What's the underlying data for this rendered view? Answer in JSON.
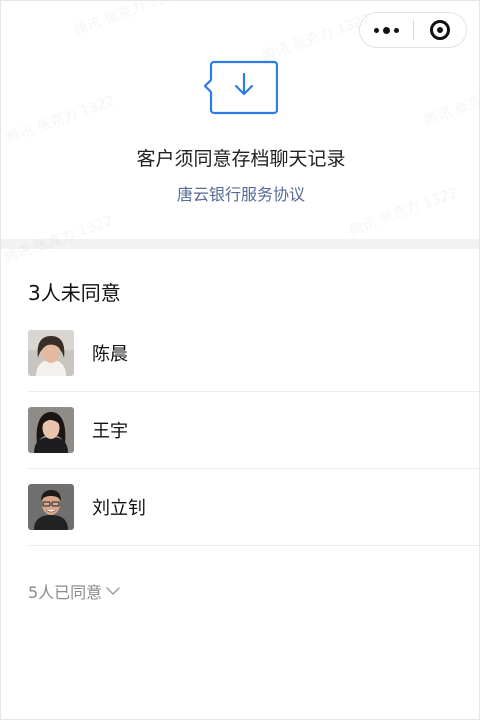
{
  "watermark": {
    "text": "腾讯 张克力 1322"
  },
  "capsule": {
    "more_icon": "more-dots-icon",
    "close_icon": "mini-program-close-icon"
  },
  "header": {
    "icon": "archive-download-icon",
    "title": "客户须同意存档聊天记录",
    "agreement_link": "唐云银行服务协议"
  },
  "not_agreed": {
    "title": "3人未同意",
    "people": [
      {
        "name": "陈晨"
      },
      {
        "name": "王宇"
      },
      {
        "name": "刘立钊"
      }
    ]
  },
  "agreed": {
    "label": "5人已同意",
    "icon": "chevron-down-icon"
  },
  "colors": {
    "link": "#576b95",
    "accent_icon": "#2f7be5",
    "divider": "#f2f2f2"
  }
}
